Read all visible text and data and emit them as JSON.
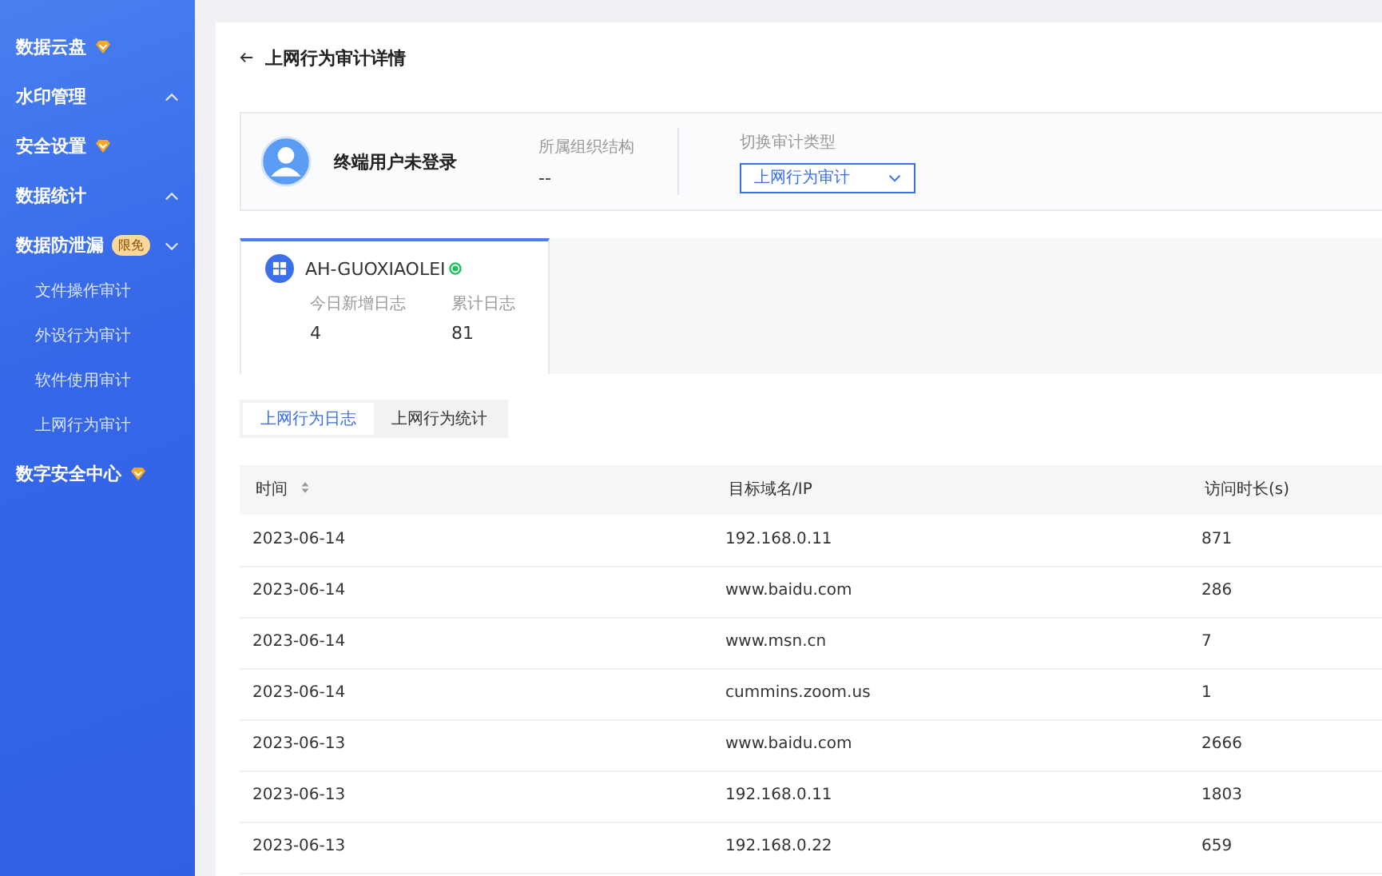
{
  "sidebar": {
    "items": [
      {
        "label": "数据云盘",
        "kind": "premium"
      },
      {
        "label": "水印管理",
        "kind": "group",
        "expanded": false
      },
      {
        "label": "安全设置",
        "kind": "premium"
      },
      {
        "label": "数据统计",
        "kind": "group",
        "expanded": false
      },
      {
        "label": "数据防泄漏",
        "kind": "group",
        "expanded": true,
        "badge": "限免",
        "children": [
          {
            "label": "文件操作审计"
          },
          {
            "label": "外设行为审计"
          },
          {
            "label": "软件使用审计"
          },
          {
            "label": "上网行为审计"
          }
        ]
      },
      {
        "label": "数字安全中心",
        "kind": "premium"
      }
    ]
  },
  "page": {
    "title": "上网行为审计详情"
  },
  "user": {
    "name": "终端用户未登录",
    "org_label": "所属组织结构",
    "org_value": "--",
    "switch_label": "切换审计类型",
    "switch_value": "上网行为审计"
  },
  "device": {
    "name": "AH-GUOXIAOLEI",
    "online": true,
    "stats": [
      {
        "label": "今日新增日志",
        "value": "4"
      },
      {
        "label": "累计日志",
        "value": "81"
      }
    ]
  },
  "tabs": [
    {
      "label": "上网行为日志",
      "selected": true
    },
    {
      "label": "上网行为统计",
      "selected": false
    }
  ],
  "table": {
    "columns": [
      {
        "label": "时间",
        "sortable": true
      },
      {
        "label": "目标域名/IP",
        "sortable": false
      },
      {
        "label": "访问时长(s)",
        "sortable": false
      }
    ],
    "rows": [
      [
        "2023-06-14",
        "192.168.0.11",
        "871"
      ],
      [
        "2023-06-14",
        "www.baidu.com",
        "286"
      ],
      [
        "2023-06-14",
        "www.msn.cn",
        "7"
      ],
      [
        "2023-06-14",
        "cummins.zoom.us",
        "1"
      ],
      [
        "2023-06-13",
        "www.baidu.com",
        "2666"
      ],
      [
        "2023-06-13",
        "192.168.0.11",
        "1803"
      ],
      [
        "2023-06-13",
        "192.168.0.22",
        "659"
      ]
    ]
  }
}
